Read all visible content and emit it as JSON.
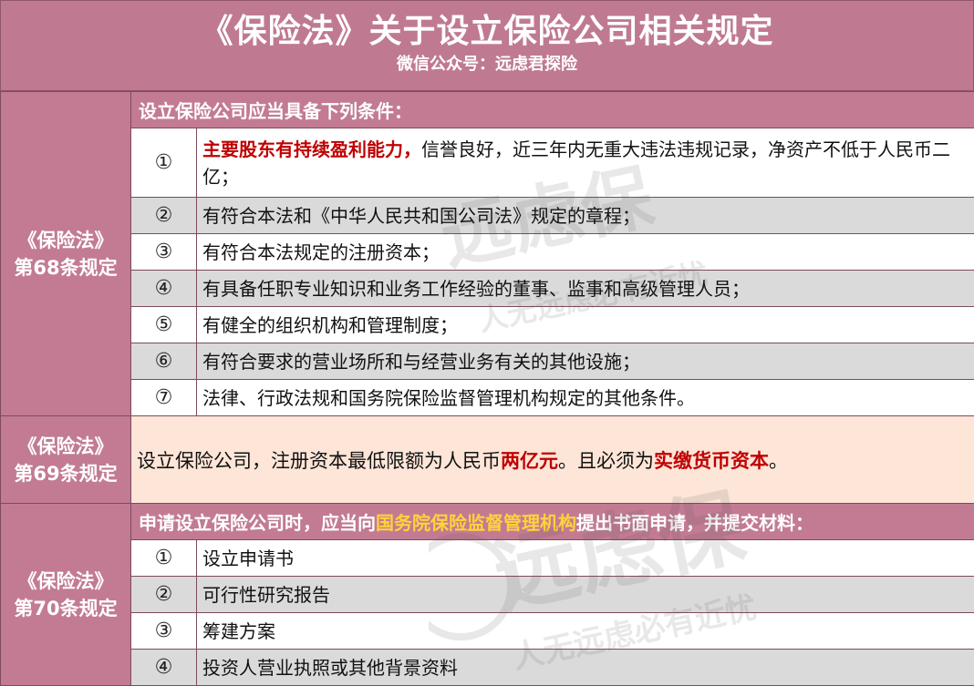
{
  "header": {
    "title": "《保险法》关于设立保险公司相关规定",
    "subtitle": "微信公众号：远虑君探险"
  },
  "art68": {
    "law_line1": "《保险法》",
    "law_line2": "第68条规定",
    "heading": "设立保险公司应当具备下列条件：",
    "items": [
      {
        "num": "①",
        "highlight": "主要股东有持续盈利能力，",
        "text": "信誉良好，近三年内无重大违法违规记录，净资产不低于人民币二亿；"
      },
      {
        "num": "②",
        "text": "有符合本法和《中华人民共和国公司法》规定的章程；"
      },
      {
        "num": "③",
        "text": "有符合本法规定的注册资本；"
      },
      {
        "num": "④",
        "text": "有具备任职专业知识和业务工作经验的董事、监事和高级管理人员；"
      },
      {
        "num": "⑤",
        "text": "有健全的组织机构和管理制度；"
      },
      {
        "num": "⑥",
        "text": "有符合要求的营业场所和与经营业务有关的其他设施；"
      },
      {
        "num": "⑦",
        "text": "法律、行政法规和国务院保险监督管理机构规定的其他条件。"
      }
    ]
  },
  "art69": {
    "law_line1": "《保险法》",
    "law_line2": "第69条规定",
    "text_a": "设立保险公司，注册资本最低限额为人民币",
    "red_a": "两亿元",
    "text_b": "。且必须为",
    "red_b": "实缴货币资本",
    "text_c": "。"
  },
  "art70": {
    "law_line1": "《保险法》",
    "law_line2": "第70条规定",
    "heading_a": "申请设立保险公司时，应当向",
    "heading_highlight": "国务院保险监督管理机构",
    "heading_b": "提出书面申请，并提交材料：",
    "items": [
      {
        "num": "①",
        "text": "设立申请书"
      },
      {
        "num": "②",
        "text": "可行性研究报告"
      },
      {
        "num": "③",
        "text": "筹建方案"
      },
      {
        "num": "④",
        "text": "投资人营业执照或其他背景资料"
      }
    ]
  },
  "watermark": {
    "brand": "远虑保",
    "slogan": "人无远虑必有近忧"
  },
  "colors": {
    "section": "#c27b93",
    "gray_row": "#dadada",
    "peach": "#fde5d8",
    "red": "#c00000",
    "yellow": "#ffd23c"
  }
}
